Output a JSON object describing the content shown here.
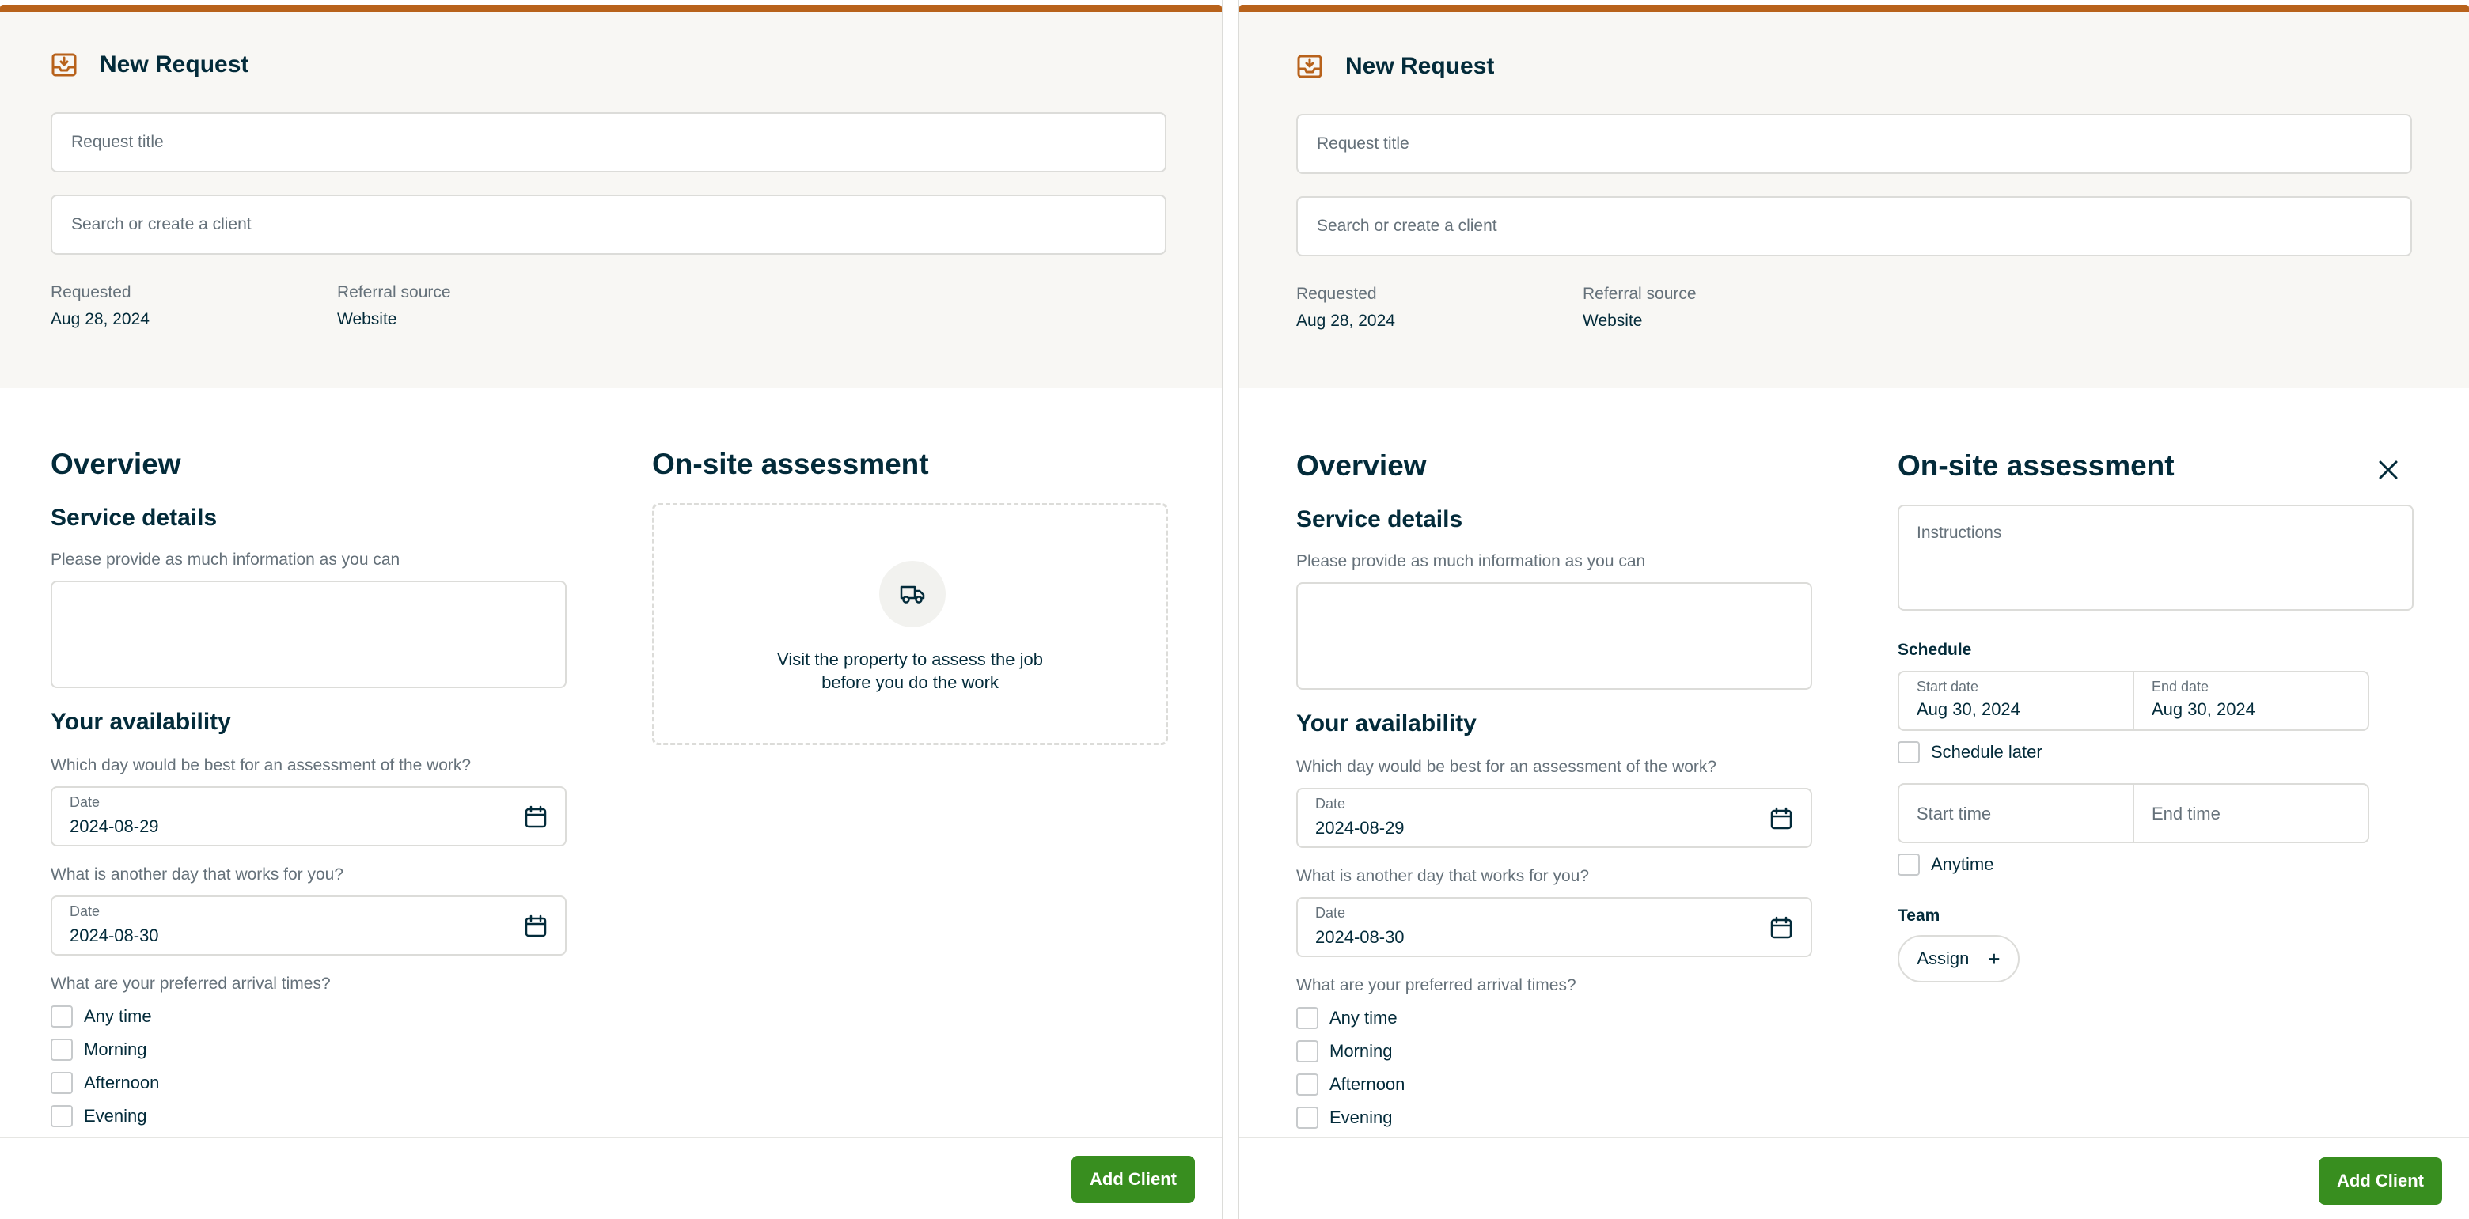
{
  "colors": {
    "accent": "#b8621b",
    "primary_button": "#388e1f",
    "text": "#032b3a",
    "muted": "#65717a",
    "header_bg": "#f8f7f4",
    "border": "#dcdcd9"
  },
  "header": {
    "title": "New Request",
    "title_icon": "inbox-download-icon",
    "request_title_placeholder": "Request title",
    "client_search_placeholder": "Search or create a client",
    "requested_label": "Requested",
    "requested_value": "Aug 28, 2024",
    "referral_label": "Referral source",
    "referral_value": "Website"
  },
  "overview": {
    "heading": "Overview",
    "service_details_heading": "Service details",
    "service_details_hint": "Please provide as much information as you can",
    "availability_heading": "Your availability",
    "first_day_question": "Which day would be best for an assessment of the work?",
    "date_label": "Date",
    "first_date": "2024-08-29",
    "second_day_question": "What is another day that works for you?",
    "second_date": "2024-08-30",
    "arrival_question": "What are your preferred arrival times?",
    "arrival_options": [
      "Any time",
      "Morning",
      "Afternoon",
      "Evening"
    ]
  },
  "assessment_empty": {
    "heading": "On-site assessment",
    "icon": "truck-icon",
    "text_line1": "Visit the property to assess the job",
    "text_line2": "before you do the work"
  },
  "assessment_form": {
    "heading": "On-site assessment",
    "close_icon": "close-icon",
    "instructions_placeholder": "Instructions",
    "schedule_heading": "Schedule",
    "start_date_label": "Start date",
    "start_date_value": "Aug 30, 2024",
    "end_date_label": "End date",
    "end_date_value": "Aug 30, 2024",
    "schedule_later_label": "Schedule later",
    "start_time_placeholder": "Start time",
    "end_time_placeholder": "End time",
    "anytime_label": "Anytime",
    "team_heading": "Team",
    "assign_label": "Assign",
    "assign_icon": "plus-icon"
  },
  "footer": {
    "add_client_label": "Add Client"
  }
}
